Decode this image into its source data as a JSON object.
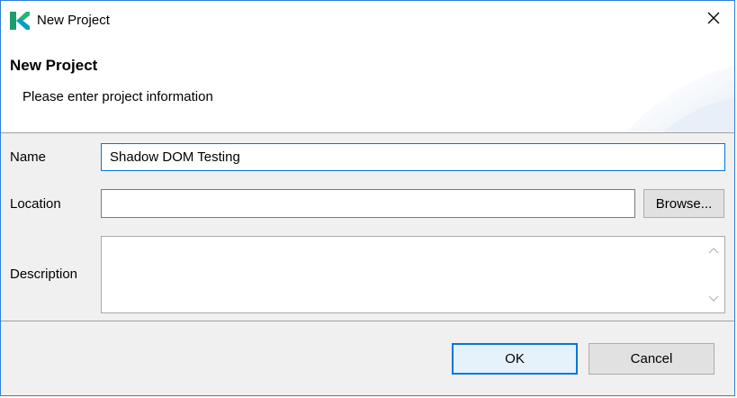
{
  "window": {
    "title": "New Project",
    "app_icon": "katalon-logo-icon",
    "close_icon": "close-icon"
  },
  "banner": {
    "title": "New Project",
    "subtitle": "Please enter project information"
  },
  "form": {
    "name_label": "Name",
    "name_value": "Shadow DOM Testing",
    "location_label": "Location",
    "location_value": "",
    "browse_label": "Browse...",
    "description_label": "Description",
    "description_value": ""
  },
  "buttons": {
    "ok_label": "OK",
    "cancel_label": "Cancel"
  },
  "colors": {
    "accent": "#0078d7",
    "window_border": "#2f7fd6",
    "dialog_bg": "#f0f0f0"
  }
}
